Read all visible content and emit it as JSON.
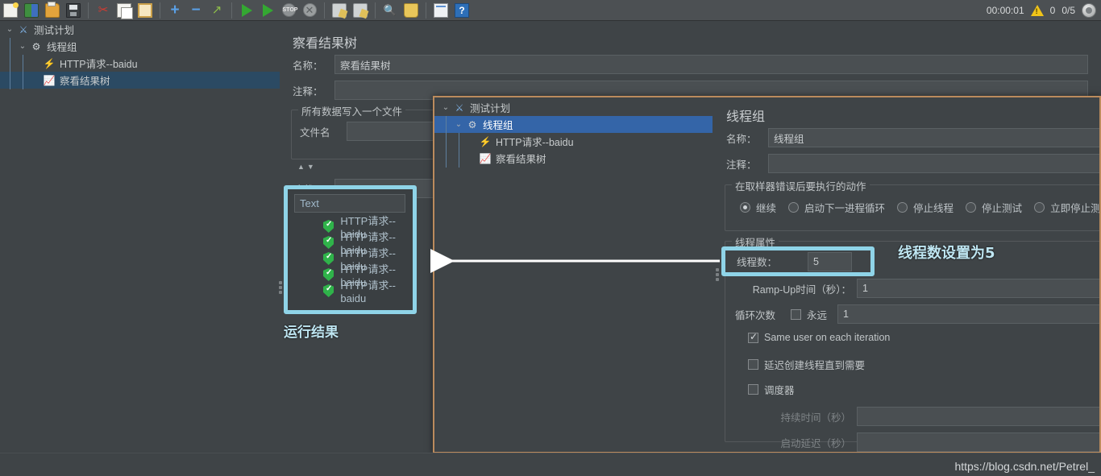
{
  "toolbar": {
    "icons": [
      {
        "name": "new-icon",
        "label": "新建",
        "glyph": "ic-doc"
      },
      {
        "name": "templates-icon",
        "label": "模板",
        "glyph": "ic-templates"
      },
      {
        "name": "open-icon",
        "label": "打开",
        "glyph": "ic-folder-open"
      },
      {
        "name": "save-icon",
        "label": "保存",
        "glyph": "ic-save"
      },
      {
        "name": "cut-icon",
        "label": "剪切",
        "glyph": "ic-scissors",
        "char": "✂"
      },
      {
        "name": "copy-icon",
        "label": "复制",
        "glyph": "ic-copy"
      },
      {
        "name": "paste-icon",
        "label": "粘贴",
        "glyph": "ic-paste"
      },
      {
        "name": "expand-all-icon",
        "label": "展开全部",
        "glyph": "ic-plus",
        "char": "+"
      },
      {
        "name": "collapse-all-icon",
        "label": "折叠全部",
        "glyph": "ic-minus",
        "char": "−"
      },
      {
        "name": "toggle-icon",
        "label": "启用/禁用",
        "glyph": "ic-toggle",
        "char": "↗"
      },
      {
        "name": "start-icon",
        "label": "启动",
        "glyph": "ic-play"
      },
      {
        "name": "start-no-pauses-icon",
        "label": "无间隔启动",
        "glyph": "ic-play"
      },
      {
        "name": "stop-icon",
        "label": "停止",
        "glyph": "ic-stop",
        "char": "STOP"
      },
      {
        "name": "shutdown-icon",
        "label": "关闭",
        "glyph": "ic-shutdown",
        "char": "✕"
      },
      {
        "name": "clear-icon",
        "label": "清除",
        "glyph": "ic-clear"
      },
      {
        "name": "clear-all-icon",
        "label": "清除全部",
        "glyph": "ic-broom"
      },
      {
        "name": "search-icon",
        "label": "查找",
        "glyph": "ic-search",
        "char": "🔍"
      },
      {
        "name": "reset-search-icon",
        "label": "重置查找",
        "glyph": "ic-broom"
      },
      {
        "name": "function-helper-icon",
        "label": "函数助手",
        "glyph": "ic-log"
      },
      {
        "name": "help-icon",
        "label": "帮助",
        "glyph": "ic-help",
        "char": "?"
      }
    ],
    "elapsed_time": "00:00:01",
    "warning_count": "0",
    "thread_counter": "0/5"
  },
  "left_tree": {
    "nodes": [
      {
        "name": "测试计划",
        "icon": "flask-icon",
        "depth": 0,
        "selected": false,
        "chevron": "⌄"
      },
      {
        "name": "线程组",
        "icon": "gear-icon",
        "depth": 1,
        "selected": false,
        "chevron": "⌄"
      },
      {
        "name": "HTTP请求--baidu",
        "icon": "pipette-icon",
        "depth": 2,
        "selected": false,
        "chevron": ""
      },
      {
        "name": "察看结果树",
        "icon": "chart-icon",
        "depth": 2,
        "selected": true,
        "chevron": ""
      }
    ]
  },
  "results_panel": {
    "title": "察看结果树",
    "name_label": "名称：",
    "name_value": "察看结果树",
    "comment_label": "注释：",
    "comment_value": "",
    "write_all_legend": "所有数据写入一个文件",
    "filename_label": "文件名",
    "filename_value": "",
    "search_label": "查找:",
    "search_value": "",
    "render_placeholder": "Text",
    "sample_results": [
      {
        "label": "HTTP请求--baidu",
        "status": "success"
      },
      {
        "label": "HTTP请求--baidu",
        "status": "success"
      },
      {
        "label": "HTTP请求--baidu",
        "status": "success"
      },
      {
        "label": "HTTP请求--baidu",
        "status": "success"
      },
      {
        "label": "HTTP请求--baidu",
        "status": "success"
      }
    ],
    "annotation": "运行结果"
  },
  "dialog": {
    "tree_nodes": [
      {
        "name": "测试计划",
        "icon": "flask-icon",
        "depth": 0,
        "selected": false,
        "chevron": "⌄"
      },
      {
        "name": "线程组",
        "icon": "gear-icon",
        "depth": 1,
        "selected": true,
        "chevron": "⌄"
      },
      {
        "name": "HTTP请求--baidu",
        "icon": "pipette-icon",
        "depth": 2,
        "selected": false,
        "chevron": ""
      },
      {
        "name": "察看结果树",
        "icon": "chart-icon",
        "depth": 2,
        "selected": false,
        "chevron": ""
      }
    ],
    "thread_group": {
      "title": "线程组",
      "name_label": "名称：",
      "name_value": "线程组",
      "comment_label": "注释：",
      "comment_value": "",
      "on_error_legend": "在取样器错误后要执行的动作",
      "on_error_options": [
        {
          "label": "继续",
          "selected": true
        },
        {
          "label": "启动下一进程循环",
          "selected": false
        },
        {
          "label": "停止线程",
          "selected": false
        },
        {
          "label": "停止测试",
          "selected": false
        },
        {
          "label": "立即停止测试",
          "selected": false
        }
      ],
      "properties_legend": "线程属性",
      "threads_label": "线程数：",
      "threads_value": "5",
      "rampup_label": "Ramp-Up时间（秒）：",
      "rampup_value": "1",
      "loops_label": "循环次数",
      "forever_label": "永远",
      "forever_checked": false,
      "loops_value": "1",
      "same_user_label": "Same user on each iteration",
      "same_user_checked": true,
      "delay_create_label": "延迟创建线程直到需要",
      "delay_create_checked": false,
      "scheduler_label": "调度器",
      "scheduler_checked": false,
      "duration_label": "持续时间（秒）",
      "duration_value": "",
      "startup_delay_label": "启动延迟（秒）",
      "startup_delay_value": "",
      "annotation": "线程数设置为5"
    }
  },
  "watermark": "https://blog.csdn.net/Petrel_",
  "colors": {
    "accent_highlight": "#8fd4e8",
    "selection_blue": "#3465a8",
    "tree_selection": "#2b4a63",
    "dialog_border": "#bb8b5d",
    "background": "#3f4447",
    "success_green": "#2fb34a"
  }
}
